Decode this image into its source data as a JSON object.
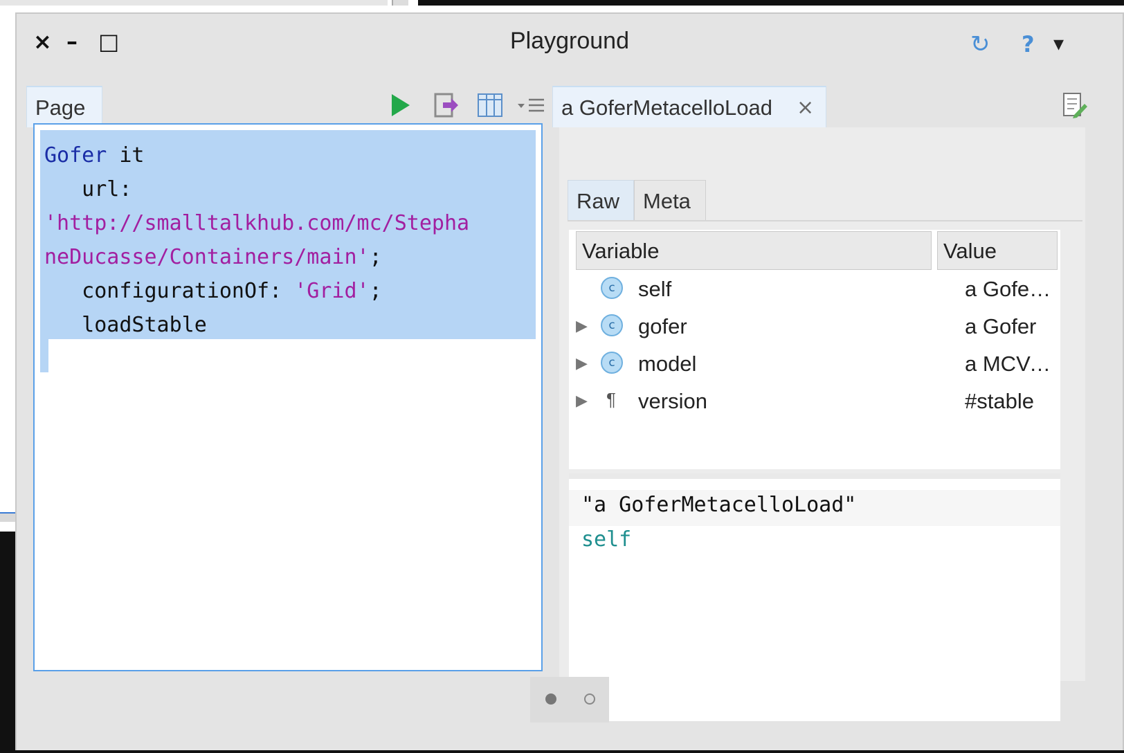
{
  "window": {
    "title": "Playground",
    "controls": [
      "×",
      "–",
      "□"
    ],
    "right_controls": {
      "sync": "↻",
      "help": "?",
      "menu": "▾"
    }
  },
  "playground": {
    "tab_label": "Page",
    "toolbar": [
      "do-it-and-go",
      "inspect",
      "bindings",
      "menu"
    ],
    "code": {
      "line1_kw": "Gofer",
      "line1_rest": " it",
      "line2": "   url:",
      "line3_str": "'http://smalltalkhub.com/mc/Stepha",
      "line4_str": "neDucasse/Containers/main'",
      "line4_rest": ";",
      "line5_pre": "   configurationOf: ",
      "line5_str": "'Grid'",
      "line5_rest": ";",
      "line6": "   loadStable"
    }
  },
  "inspector": {
    "tab_label": "a GoferMetacelloLoad",
    "close": "×",
    "subtabs": [
      "Raw",
      "Meta"
    ],
    "columns": [
      "Variable",
      "Value"
    ],
    "rows": [
      {
        "expandable": false,
        "icon": "c",
        "name": "self",
        "value": "a GoferM..."
      },
      {
        "expandable": true,
        "icon": "c",
        "name": "gofer",
        "value": "a Gofer"
      },
      {
        "expandable": true,
        "icon": "c",
        "name": "model",
        "value": "a MCVers..."
      },
      {
        "expandable": true,
        "icon": "¶",
        "name": "version",
        "value": "#stable"
      }
    ],
    "eval_code": {
      "line1": "\"a GoferMetacelloLoad\"",
      "line2": "self"
    }
  },
  "pager": {
    "pages": 2,
    "current": 1
  }
}
